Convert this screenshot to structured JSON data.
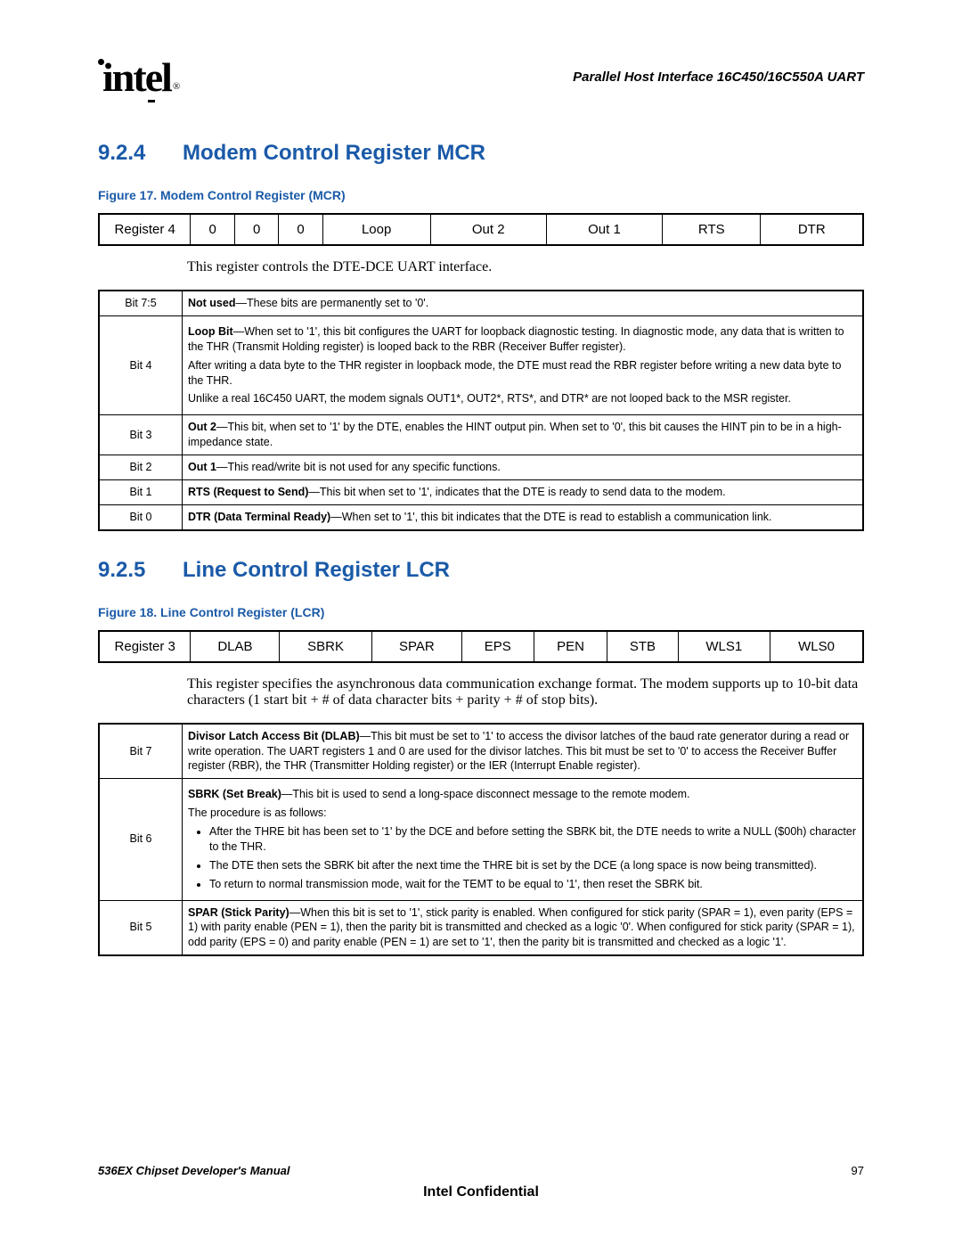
{
  "header": {
    "logo_text": "intel",
    "right_title": "Parallel Host Interface 16C450/16C550A UART"
  },
  "section1": {
    "number": "9.2.4",
    "title": "Modem Control Register MCR",
    "fig_caption": "Figure 17. Modem Control Register (MCR)",
    "reg_row": [
      "Register 4",
      "0",
      "0",
      "0",
      "Loop",
      "Out 2",
      "Out 1",
      "RTS",
      "DTR"
    ],
    "body": "This register controls the DTE-DCE UART interface.",
    "desc": [
      {
        "bit": "Bit 7:5",
        "html": "<b>Not used</b>—These bits are permanently set to '0'."
      },
      {
        "bit": "Bit 4",
        "html": "<p><b>Loop Bit</b>—When set to '1', this bit configures the UART for loopback diagnostic testing. In diagnostic mode, any data that is written to the THR (Transmit Holding register) is looped back to the RBR (Receiver Buffer register).</p><p>After writing a data byte to the THR register in loopback mode, the DTE must read the RBR register before writing a new data byte to the THR.</p><p>Unlike a real 16C450 UART, the modem signals OUT1*, OUT2*, RTS*, and DTR* are not looped back to the MSR register.</p>"
      },
      {
        "bit": "Bit 3",
        "html": "<b>Out 2</b>—This bit, when set to '1' by the DTE, enables the HINT output pin. When set to '0', this bit causes the HINT pin to be in a high-impedance state."
      },
      {
        "bit": "Bit 2",
        "html": "<b>Out 1</b>—This read/write bit is not used for any specific functions."
      },
      {
        "bit": "Bit 1",
        "html": "<b>RTS (Request to Send)</b>—This bit when set to '1', indicates that the DTE is ready to send data to the modem."
      },
      {
        "bit": "Bit 0",
        "html": "<b>DTR (Data Terminal Ready)</b>—When set to '1', this bit indicates that the DTE is read to establish a communication link."
      }
    ]
  },
  "section2": {
    "number": "9.2.5",
    "title": "Line Control Register LCR",
    "fig_caption": "Figure 18. Line Control Register (LCR)",
    "reg_row": [
      "Register 3",
      "DLAB",
      "SBRK",
      "SPAR",
      "EPS",
      "PEN",
      "STB",
      "WLS1",
      "WLS0"
    ],
    "body": "This register specifies the asynchronous data communication exchange format. The modem supports up to 10-bit data characters (1 start bit + # of data character bits + parity + # of stop bits).",
    "desc": [
      {
        "bit": "Bit 7",
        "html": "<b>Divisor Latch Access Bit (DLAB)</b>—This bit must be set to '1' to access the divisor latches of the baud rate generator during a read or write operation. The UART registers 1 and 0 are used for the divisor latches. This bit must be set to '0' to access the Receiver Buffer register (RBR), the THR (Transmitter Holding register) or the IER (Interrupt Enable register)."
      },
      {
        "bit": "Bit 6",
        "html": "<p><b>SBRK (Set Break)</b>—This bit is used to send a long-space disconnect message to the remote modem.</p><p>The procedure is as follows:</p><ul><li>After the THRE bit has been set to '1' by the DCE and before setting the SBRK bit, the DTE needs to write a NULL ($00h) character to the THR.</li><li>The DTE then sets the SBRK bit after the next time the THRE bit is set by the DCE (a long space is now being transmitted).</li><li>To return to normal transmission mode, wait for the TEMT to be equal to '1', then reset the SBRK bit.</li></ul>"
      },
      {
        "bit": "Bit 5",
        "html": "<b>SPAR (Stick Parity)</b>—When this bit is set to '1', stick parity is enabled. When configured for stick parity (SPAR = 1), even parity (EPS = 1) with parity enable (PEN = 1), then the parity bit is transmitted and checked as a logic '0'. When configured for stick parity (SPAR = 1), odd parity (EPS = 0) and parity enable (PEN = 1) are set to '1', then the parity bit is transmitted and checked as a logic '1'."
      }
    ]
  },
  "footer": {
    "manual": "536EX Chipset Developer's Manual",
    "page": "97",
    "confidential": "Intel Confidential"
  }
}
